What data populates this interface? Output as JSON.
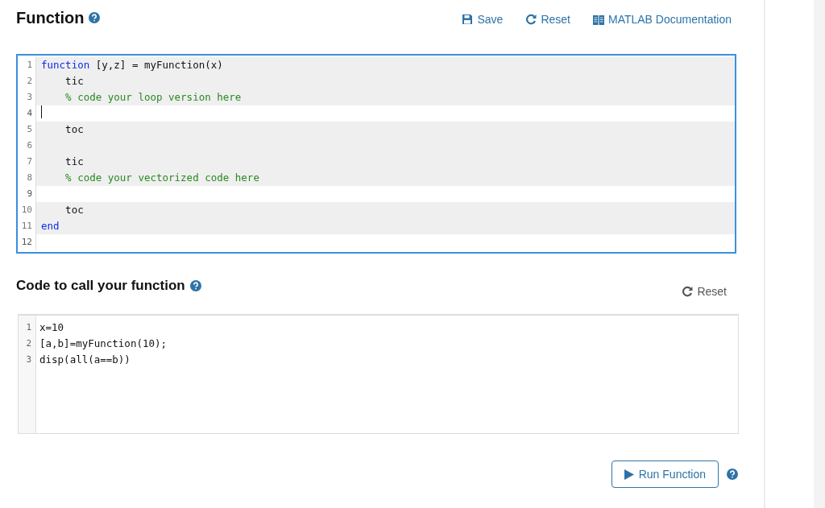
{
  "header": {
    "title": "Function",
    "actions": [
      {
        "kind": "save",
        "label": "Save"
      },
      {
        "kind": "reset",
        "label": "Reset"
      },
      {
        "kind": "docs",
        "label": "MATLAB Documentation"
      }
    ]
  },
  "function_editor": {
    "lines": [
      {
        "number": "1",
        "editable": false,
        "tokens": [
          {
            "kind": "keyword",
            "text": "function"
          },
          {
            "kind": "plain",
            "text": " [y,z] = myFunction(x)"
          }
        ]
      },
      {
        "number": "2",
        "editable": false,
        "tokens": [
          {
            "kind": "plain",
            "text": "    tic"
          }
        ]
      },
      {
        "number": "3",
        "editable": false,
        "tokens": [
          {
            "kind": "comment",
            "text": "    % code your loop version here"
          }
        ]
      },
      {
        "number": "4",
        "editable": true,
        "cursor": true
      },
      {
        "number": "5",
        "editable": false,
        "tokens": [
          {
            "kind": "plain",
            "text": "    toc"
          }
        ]
      },
      {
        "number": "6",
        "editable": false
      },
      {
        "number": "7",
        "editable": false,
        "tokens": [
          {
            "kind": "plain",
            "text": "    tic"
          }
        ]
      },
      {
        "number": "8",
        "editable": false,
        "tokens": [
          {
            "kind": "comment",
            "text": "    % code your vectorized code here"
          }
        ]
      },
      {
        "number": "9",
        "editable": true
      },
      {
        "number": "10",
        "editable": false,
        "tokens": [
          {
            "kind": "plain",
            "text": "    toc"
          }
        ]
      },
      {
        "number": "11",
        "editable": false,
        "tokens": [
          {
            "kind": "keyword",
            "text": "end"
          }
        ]
      },
      {
        "number": "12",
        "editable": true
      }
    ]
  },
  "call_section": {
    "title": "Code to call your function",
    "reset_label": "Reset"
  },
  "call_editor": {
    "lines": [
      {
        "number": "1",
        "text": "x=10"
      },
      {
        "number": "2",
        "text": "[a,b]=myFunction(10);"
      },
      {
        "number": "3",
        "text": "disp(all(a==b))"
      }
    ]
  },
  "run_button": {
    "label": "Run Function"
  }
}
